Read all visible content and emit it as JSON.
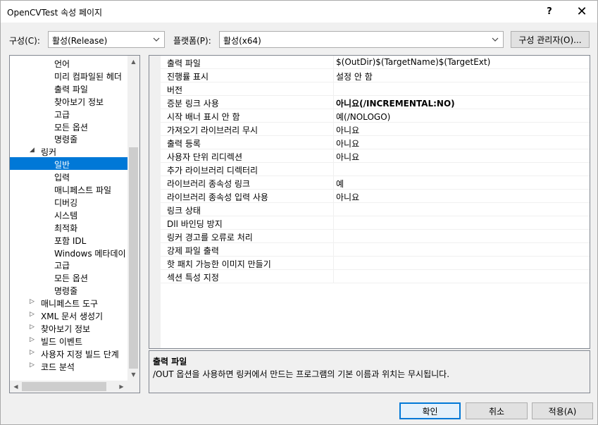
{
  "window": {
    "title": "OpenCVTest 속성 페이지",
    "help_label": "?",
    "close_label": "✕"
  },
  "config_bar": {
    "config_label": "구성(C):",
    "config_value": "활성(Release)",
    "platform_label": "플랫폼(P):",
    "platform_value": "활성(x64)",
    "config_manager_label": "구성 관리자(O)..."
  },
  "tree": {
    "items": [
      {
        "label": "언어",
        "level": 2,
        "expander": ""
      },
      {
        "label": "미리 컴파일된 헤더",
        "level": 2,
        "expander": ""
      },
      {
        "label": "출력 파일",
        "level": 2,
        "expander": ""
      },
      {
        "label": "찾아보기 정보",
        "level": 2,
        "expander": ""
      },
      {
        "label": "고급",
        "level": 2,
        "expander": ""
      },
      {
        "label": "모든 옵션",
        "level": 2,
        "expander": ""
      },
      {
        "label": "명령줄",
        "level": 2,
        "expander": ""
      },
      {
        "label": "링커",
        "level": 1,
        "expander": "◢"
      },
      {
        "label": "일반",
        "level": 2,
        "expander": "",
        "selected": true
      },
      {
        "label": "입력",
        "level": 2,
        "expander": ""
      },
      {
        "label": "매니페스트 파일",
        "level": 2,
        "expander": ""
      },
      {
        "label": "디버깅",
        "level": 2,
        "expander": ""
      },
      {
        "label": "시스템",
        "level": 2,
        "expander": ""
      },
      {
        "label": "최적화",
        "level": 2,
        "expander": ""
      },
      {
        "label": "포함 IDL",
        "level": 2,
        "expander": ""
      },
      {
        "label": "Windows 메타데이",
        "level": 2,
        "expander": ""
      },
      {
        "label": "고급",
        "level": 2,
        "expander": ""
      },
      {
        "label": "모든 옵션",
        "level": 2,
        "expander": ""
      },
      {
        "label": "명령줄",
        "level": 2,
        "expander": ""
      },
      {
        "label": "매니페스트 도구",
        "level": 1,
        "expander": "▷"
      },
      {
        "label": "XML 문서 생성기",
        "level": 1,
        "expander": "▷"
      },
      {
        "label": "찾아보기 정보",
        "level": 1,
        "expander": "▷"
      },
      {
        "label": "빌드 이벤트",
        "level": 1,
        "expander": "▷"
      },
      {
        "label": "사용자 지정 빌드 단계",
        "level": 1,
        "expander": "▷"
      },
      {
        "label": "코드 분석",
        "level": 1,
        "expander": "▷"
      }
    ],
    "scroll_up": "▲",
    "scroll_down": "▼",
    "scroll_left": "◀",
    "scroll_right": "▶"
  },
  "properties": {
    "rows": [
      {
        "name": "출력 파일",
        "value": "$(OutDir)$(TargetName)$(TargetExt)",
        "bold": false
      },
      {
        "name": "진행률 표시",
        "value": "설정 안 함",
        "bold": false
      },
      {
        "name": "버전",
        "value": "",
        "bold": false
      },
      {
        "name": "증분 링크 사용",
        "value": "아니요(/INCREMENTAL:NO)",
        "bold": true
      },
      {
        "name": "시작 배너 표시 안 함",
        "value": "예(/NOLOGO)",
        "bold": false
      },
      {
        "name": "가져오기 라이브러리 무시",
        "value": "아니요",
        "bold": false
      },
      {
        "name": "출력 등록",
        "value": "아니요",
        "bold": false
      },
      {
        "name": "사용자 단위 리디렉션",
        "value": "아니요",
        "bold": false
      },
      {
        "name": "추가 라이브러리 디렉터리",
        "value": "",
        "bold": false
      },
      {
        "name": "라이브러리 종속성 링크",
        "value": "예",
        "bold": false
      },
      {
        "name": "라이브러리 종속성 입력 사용",
        "value": "아니요",
        "bold": false
      },
      {
        "name": "링크 상태",
        "value": "",
        "bold": false
      },
      {
        "name": "Dll 바인딩 방지",
        "value": "",
        "bold": false
      },
      {
        "name": "링커 경고를 오류로 처리",
        "value": "",
        "bold": false
      },
      {
        "name": "강제 파일 출력",
        "value": "",
        "bold": false
      },
      {
        "name": "핫 패치 가능한 이미지 만들기",
        "value": "",
        "bold": false
      },
      {
        "name": "섹션 특성 지정",
        "value": "",
        "bold": false
      }
    ]
  },
  "description": {
    "title": "출력 파일",
    "text": "/OUT 옵션을 사용하면 링커에서 만드는 프로그램의 기본 이름과 위치는 무시됩니다."
  },
  "buttons": {
    "ok": "확인",
    "cancel": "취소",
    "apply": "적용(A)"
  }
}
